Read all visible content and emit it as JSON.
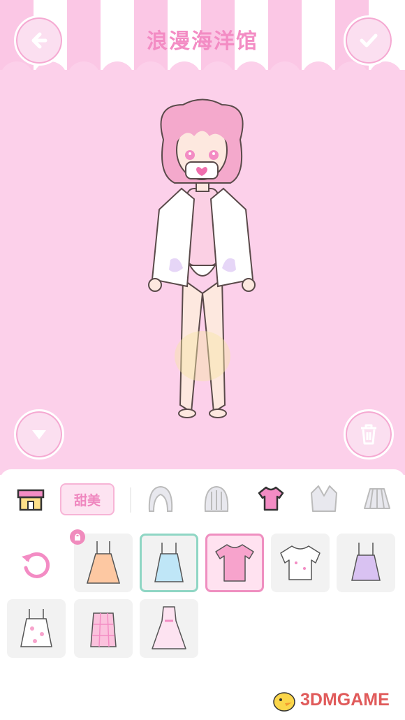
{
  "header": {
    "title": "浪漫海洋馆"
  },
  "buttons": {
    "back_icon": "back-arrow-icon",
    "confirm_icon": "check-icon",
    "collapse_icon": "triangle-down-icon",
    "delete_icon": "trash-icon"
  },
  "categories": {
    "style_tag": "甜美",
    "tabs": [
      "shop",
      "hair-front",
      "hair-back",
      "top",
      "coat",
      "skirt"
    ],
    "active": "top"
  },
  "items": [
    {
      "name": "orange-sundress",
      "locked": true,
      "selected": false
    },
    {
      "name": "blue-camisole",
      "locked": false,
      "selected": true,
      "ring": "teal"
    },
    {
      "name": "pink-tee",
      "locked": false,
      "selected": true,
      "ring": "pink"
    },
    {
      "name": "white-frill-shirt",
      "locked": false,
      "selected": false
    },
    {
      "name": "lavender-cami",
      "locked": false,
      "selected": false
    },
    {
      "name": "polka-cami",
      "locked": false,
      "selected": false
    },
    {
      "name": "gingham-top",
      "locked": false,
      "selected": false
    },
    {
      "name": "pink-ribbon-dress",
      "locked": false,
      "selected": false
    }
  ],
  "watermark": {
    "text": "3DMGAME"
  },
  "colors": {
    "accent": "#f38cc4",
    "stage": "#fcd0ea",
    "teal": "#8fd6c4"
  }
}
